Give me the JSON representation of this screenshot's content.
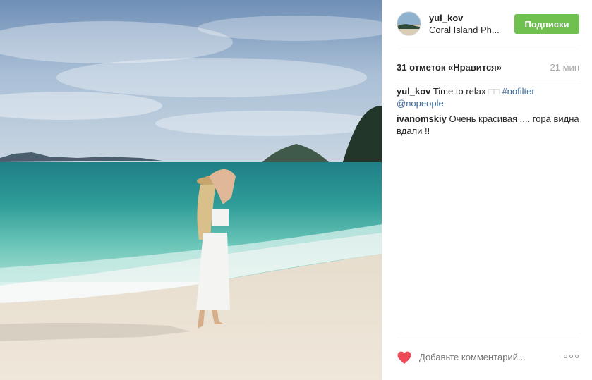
{
  "post": {
    "image_alt": "Woman in white skirt and straw hat on tropical beach",
    "user": {
      "username": "yul_kov",
      "location": "Coral Island Ph...",
      "follow_label": "Подписки"
    },
    "likes_text": "31 отметок «Нравится»",
    "time_ago": "21 мин",
    "caption": {
      "username": "yul_kov",
      "text": "Time to relax",
      "glyphs": "□□",
      "hashtag": "#nofilter",
      "mention": "@nopeople"
    },
    "comments": [
      {
        "username": "ivanomskiy",
        "text": "Очень красивая .... гора видна вдали !!"
      }
    ],
    "comment_placeholder": "Добавьте комментарий...",
    "icons": {
      "like": "heart-icon",
      "options": "more-options-icon"
    },
    "colors": {
      "follow_button": "#70c050",
      "like_icon": "#ed4956",
      "link": "#3b6a9b",
      "muted": "#999999"
    }
  }
}
